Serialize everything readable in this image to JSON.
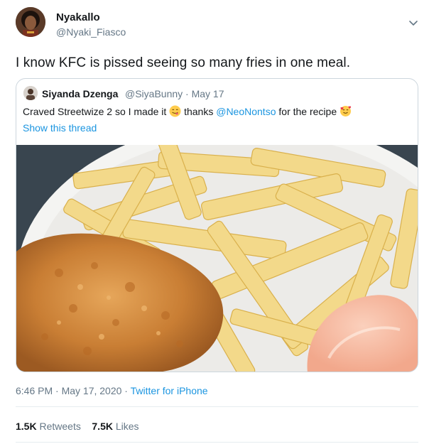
{
  "tweet": {
    "author_name": "Nyakallo",
    "author_handle": "@Nyaki_Fiasco",
    "text": "I know KFC is pissed seeing so many fries in one meal.",
    "timestamp": "6:46 PM · May 17, 2020",
    "separator": " · ",
    "source": "Twitter for iPhone",
    "retweets_count": "1.5K",
    "retweets_label": "Retweets",
    "likes_count": "7.5K",
    "likes_label": "Likes",
    "menu_icon": "chevron-down-icon"
  },
  "quoted": {
    "author_name": "Siyanda Dzenga",
    "author_handle": "@SiyaBunny",
    "date": "· May 17",
    "text_part1": "Craved Streetwize 2 so I made it",
    "text_part2": "thanks",
    "mention": "@NeoNontso",
    "text_part3": "for the recipe",
    "show_thread": "Show this thread",
    "emoji1": "savoring-food-emoji",
    "emoji2": "smiling-face-with-hearts-emoji"
  },
  "colors": {
    "link": "#1b95e0",
    "secondary_text": "#657786",
    "border": "#ccd6dd"
  }
}
